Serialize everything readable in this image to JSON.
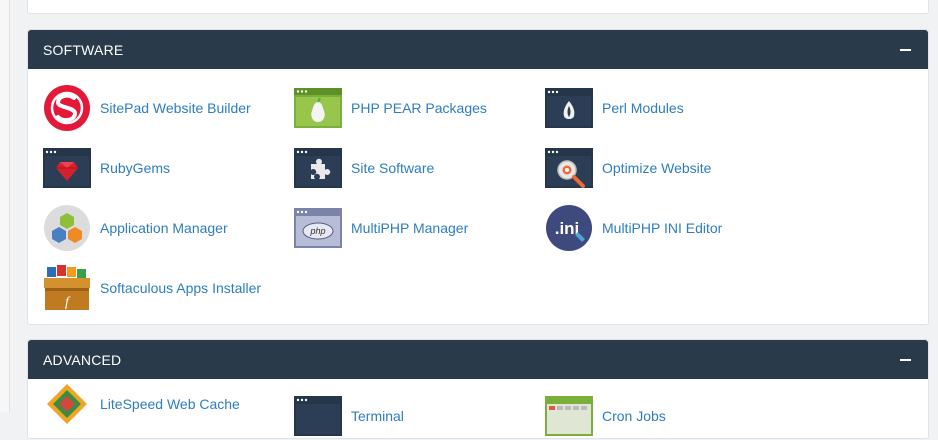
{
  "software": {
    "title": "SOFTWARE",
    "items": [
      {
        "label": "SitePad Website Builder",
        "icon": "sitepad-icon"
      },
      {
        "label": "PHP PEAR Packages",
        "icon": "php-pear-icon"
      },
      {
        "label": "Perl Modules",
        "icon": "perl-icon"
      },
      {
        "label": "RubyGems",
        "icon": "rubygems-icon"
      },
      {
        "label": "Site Software",
        "icon": "site-software-icon"
      },
      {
        "label": "Optimize Website",
        "icon": "optimize-website-icon"
      },
      {
        "label": "Application Manager",
        "icon": "application-manager-icon"
      },
      {
        "label": "MultiPHP Manager",
        "icon": "multiphp-manager-icon"
      },
      {
        "label": "MultiPHP INI Editor",
        "icon": "multiphp-ini-editor-icon"
      },
      {
        "label": "Softaculous Apps Installer",
        "icon": "softaculous-icon"
      }
    ]
  },
  "advanced": {
    "title": "ADVANCED",
    "items": [
      {
        "label": "LiteSpeed Web Cache",
        "icon": "litespeed-icon"
      },
      {
        "label": "Terminal",
        "icon": "terminal-icon"
      },
      {
        "label": "Cron Jobs",
        "icon": "cron-jobs-icon"
      }
    ]
  },
  "icon_text": {
    "php": "php",
    "ini": ".ini"
  },
  "colors": {
    "header_bg": "#293a4a",
    "link": "#2d7dbf",
    "page_bg": "#f1f2f4"
  }
}
